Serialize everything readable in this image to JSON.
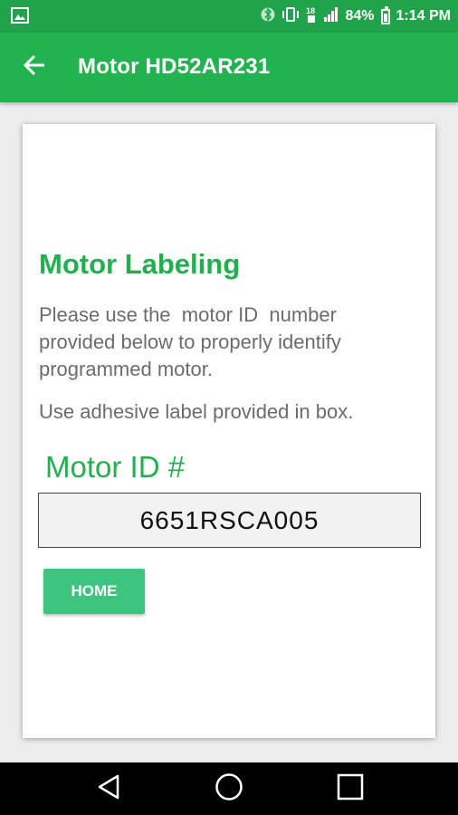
{
  "status_bar": {
    "battery_percent": "84%",
    "time": "1:14 PM",
    "icons": [
      "image-notification-icon",
      "bluetooth-icon",
      "vibrate-icon",
      "data-icon",
      "signal-icon",
      "battery-icon"
    ]
  },
  "app_bar": {
    "title": "Motor HD52AR231",
    "back_icon": "arrow-back-icon"
  },
  "card": {
    "heading": "Motor Labeling",
    "instructions": "Please use the  motor ID  number\nprovided below to properly identify\nprogrammed motor.",
    "adhesive_note": "Use adhesive label provided in box.",
    "motor_id_label": "Motor ID #",
    "motor_id_value": "6651RSCA005",
    "home_button_label": "HOME"
  },
  "nav_bar": {
    "buttons": [
      "back-triangle-icon",
      "home-circle-icon",
      "recents-square-icon"
    ]
  },
  "colors": {
    "status_bar": "#20a34a",
    "app_bar": "#22b24f",
    "accent_text": "#21b04d",
    "button": "#3fc47f",
    "body_text": "#6c6c6c"
  }
}
